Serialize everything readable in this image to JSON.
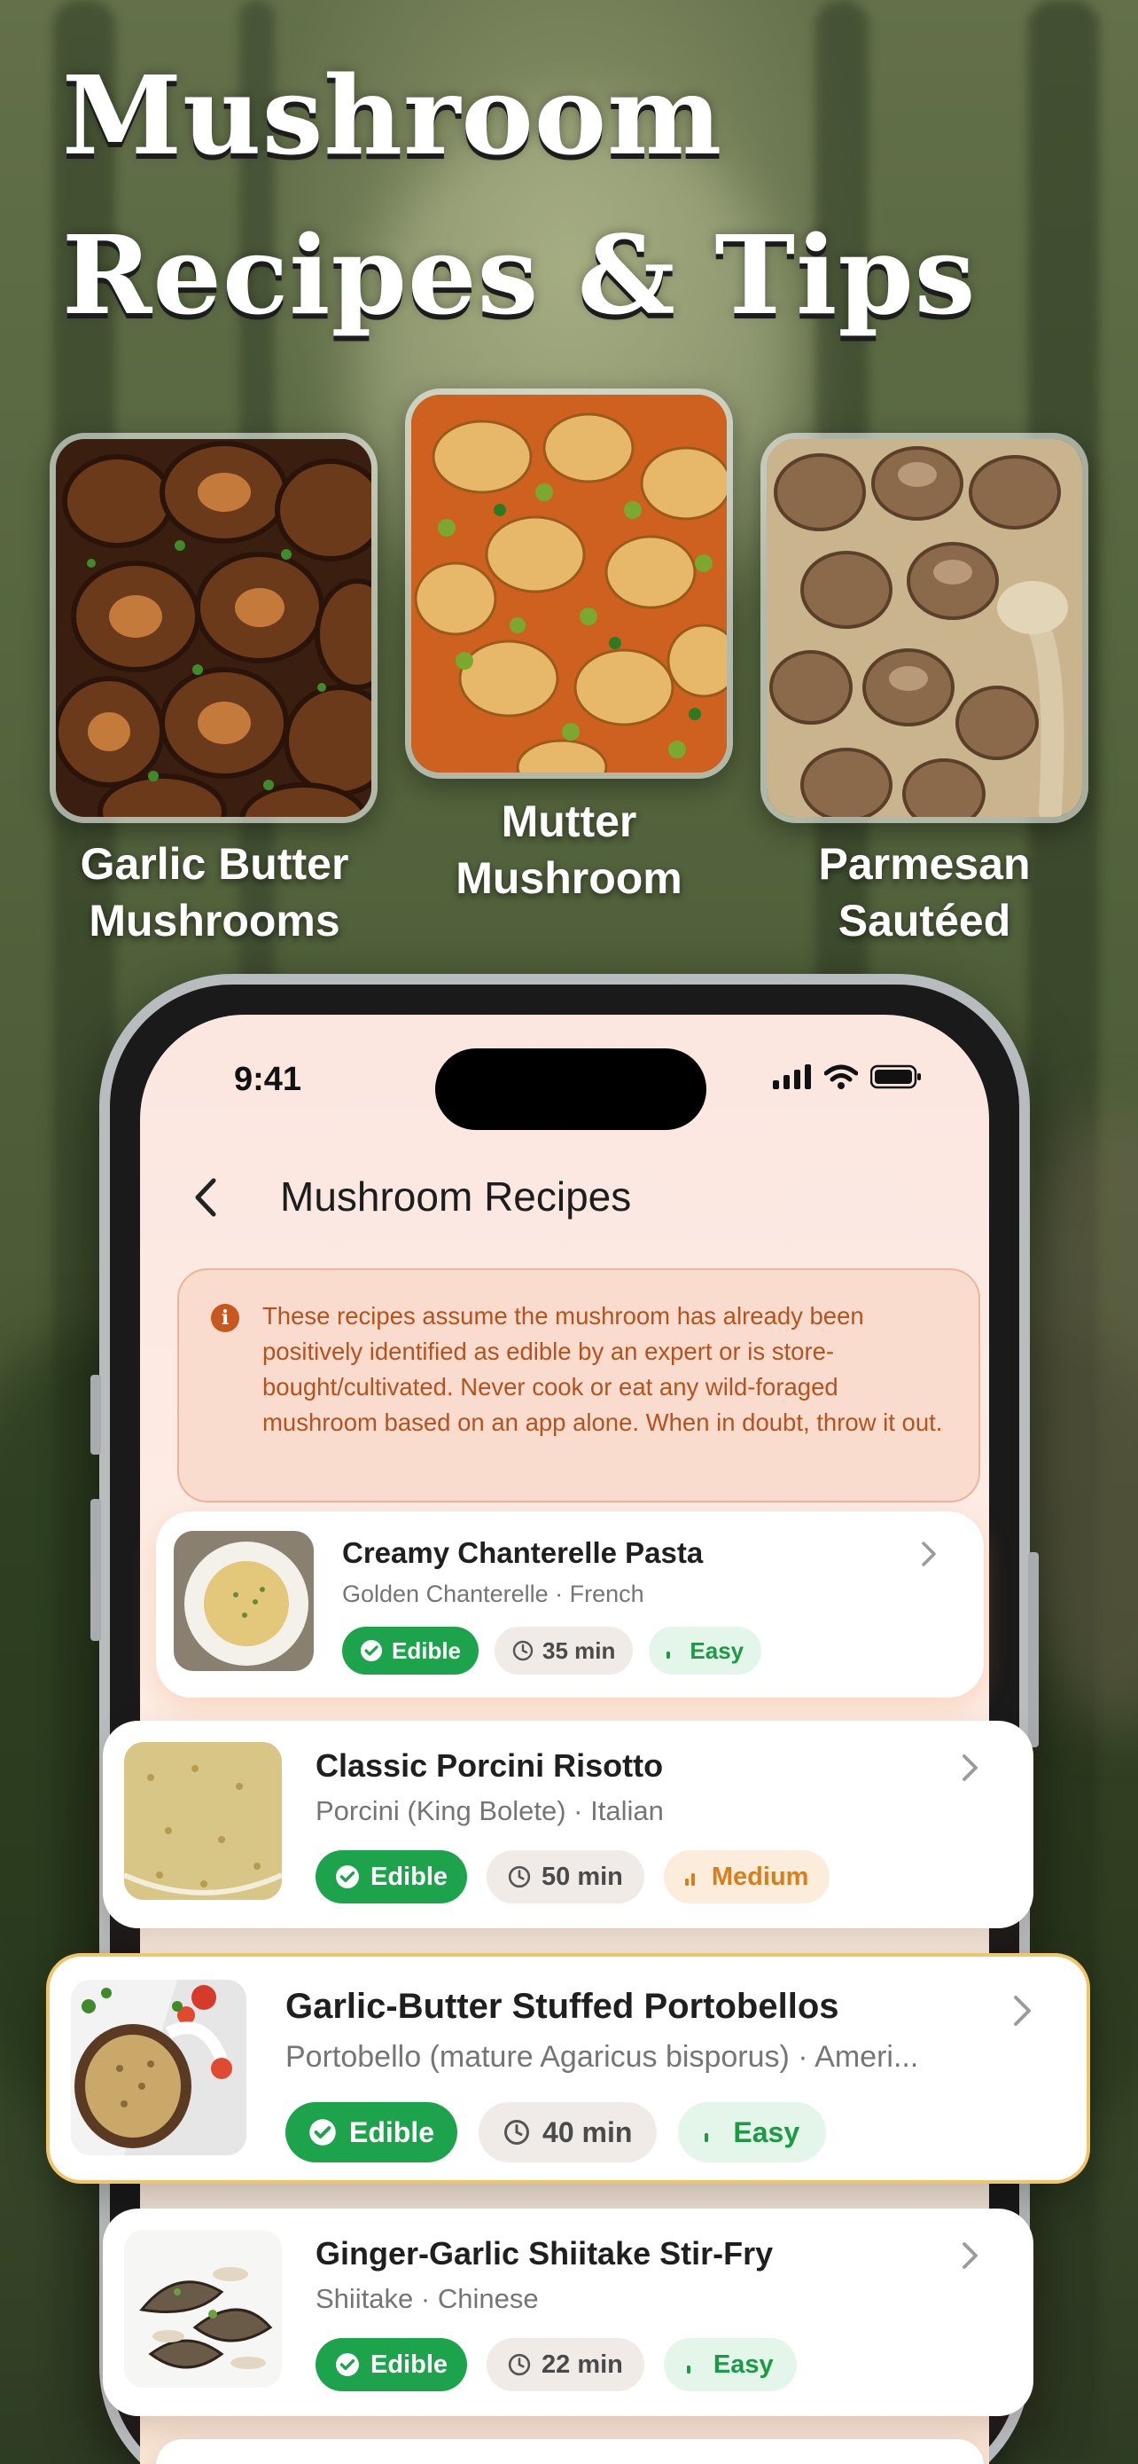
{
  "hero": {
    "title_line1": "Mushroom",
    "title_line2": "Recipes & Tips"
  },
  "showcase": [
    {
      "caption_line1": "Garlic Butter",
      "caption_line2": "Mushrooms"
    },
    {
      "caption_line1": "Mutter",
      "caption_line2": "Mushroom"
    },
    {
      "caption_line1": "Parmesan",
      "caption_line2": "Sautéed"
    }
  ],
  "status_bar": {
    "time": "9:41"
  },
  "nav": {
    "title": "Mushroom Recipes",
    "back_icon": "chevron-left-icon"
  },
  "warning": {
    "icon": "info-icon",
    "text": "These recipes assume the mushroom has already been positively identified as edible by an expert or is store-bought/cultivated. Never cook or eat any wild-foraged mushroom based on an app alone. When in doubt, throw it out."
  },
  "recipes": [
    {
      "title": "Creamy Chanterelle Pasta",
      "subtitle": "Golden Chanterelle · French",
      "status": "Edible",
      "time": "35 min",
      "difficulty": "Easy"
    },
    {
      "title": "Classic Porcini Risotto",
      "subtitle": "Porcini (King Bolete) · Italian",
      "status": "Edible",
      "time": "50 min",
      "difficulty": "Medium"
    },
    {
      "title": "Garlic-Butter Stuffed Portobellos",
      "subtitle": "Portobello (mature Agaricus bisporus) · Ameri...",
      "status": "Edible",
      "time": "40 min",
      "difficulty": "Easy"
    },
    {
      "title": "Ginger-Garlic Shiitake Stir-Fry",
      "subtitle": "Shiitake · Chinese",
      "status": "Edible",
      "time": "22 min",
      "difficulty": "Easy"
    }
  ],
  "colors": {
    "edible": "#1ea34d",
    "medium": "#d77f1c",
    "warning_text": "#b5521e",
    "highlight_border": "#f2c46a"
  }
}
